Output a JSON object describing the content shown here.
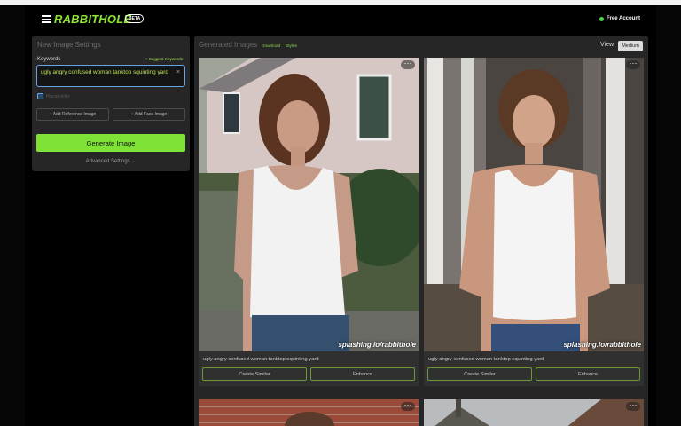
{
  "app": {
    "logo": "RABBITHOLE",
    "badge": "BETA",
    "account": "Free Account"
  },
  "settings": {
    "title": "New Image Settings",
    "keywords_label": "Keywords",
    "suggest": "+ Suggest Keywords",
    "keywords_value": "ugly angry confused woman tanktop squinting yard",
    "clear": "×",
    "checkbox_label": "Placeholder",
    "add_reference": "+ Add Reference Image",
    "add_face": "+ Add Face Image",
    "generate": "Generate Image",
    "advanced": "Advanced Settings ⌄"
  },
  "results": {
    "title": "Generated Images",
    "download": "Download",
    "styles": "Styles",
    "view_label": "View",
    "view_value": "Medium",
    "cards": [
      {
        "watermark": "splashing.io/rabbithole",
        "caption": "ugly angry confused woman tanktop squinting yard",
        "create_similar": "Create Similar",
        "enhance": "Enhance",
        "more": "···"
      },
      {
        "watermark": "splashing.io/rabbithole",
        "caption": "ugly angry confused woman tanktop squinting yard",
        "create_similar": "Create Similar",
        "enhance": "Enhance",
        "more": "···"
      },
      {
        "more": "···"
      },
      {
        "more": "···"
      }
    ]
  },
  "colors": {
    "accent": "#7fe236",
    "panel": "#262626",
    "focus_border": "#6aa4e0",
    "status_online": "#4ed34a"
  }
}
